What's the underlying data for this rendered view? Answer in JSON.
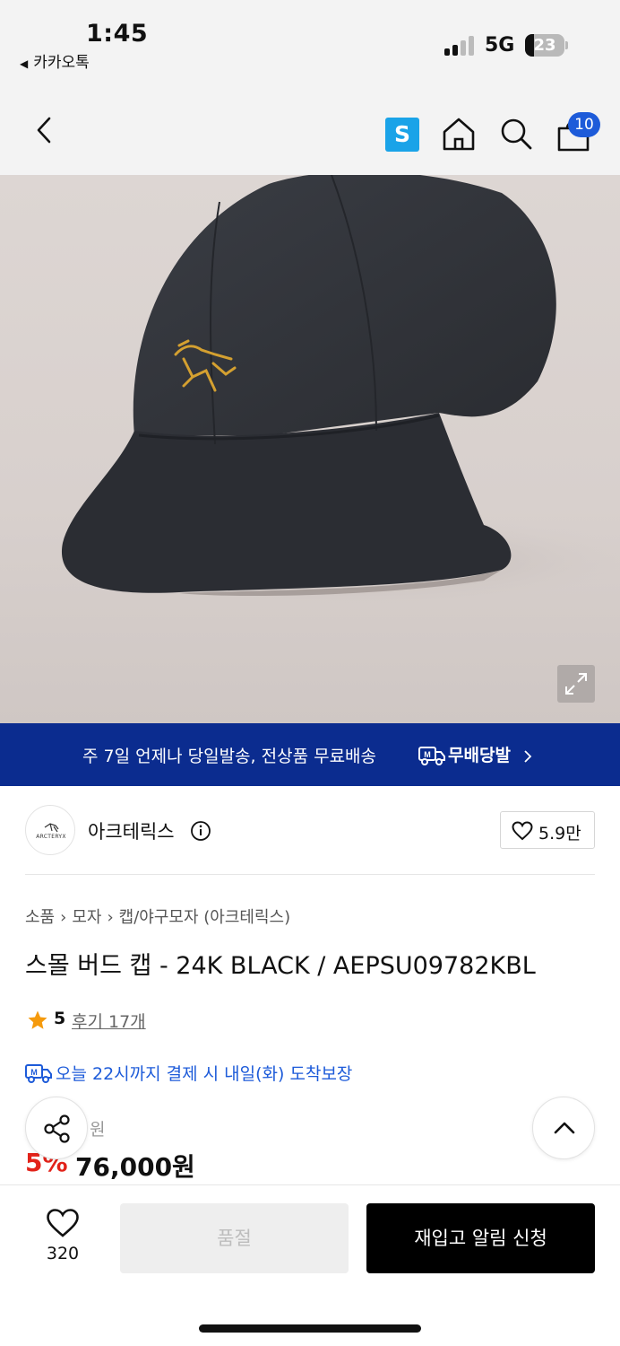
{
  "status_bar": {
    "time": "1:45",
    "back_app": "카카오톡",
    "network": "5G",
    "battery_level": 23,
    "battery_text": "23"
  },
  "nav": {
    "s_badge": "S",
    "cart_count": "10",
    "icons": [
      "back-chevron-icon",
      "s-app-icon",
      "home-icon",
      "search-icon",
      "cart-icon"
    ]
  },
  "banner": {
    "text": "주 7일 언제나 당일발송, 전상품 무료배송",
    "badge": "무배당발"
  },
  "brand": {
    "logo_text": "ARCTERYX",
    "name": "아크테릭스",
    "likes": "5.9만"
  },
  "breadcrumb": [
    "소품",
    "모자",
    "캡/야구모자 (아크테릭스)"
  ],
  "product": {
    "title": "스몰 버드 캡 - 24K BLACK / AEPSU09782KBL",
    "rating": "5",
    "reviews": "후기 17개",
    "delivery": "오늘 22시까지 결제 시 내일(화) 도착보장",
    "original_price": "원",
    "discount": "5%",
    "price": "76,000원"
  },
  "bottom_bar": {
    "wish_count": "320",
    "soldout_label": "품절",
    "restock_label": "재입고 알림 신청"
  },
  "colors": {
    "accent_blue": "#1d5bd9",
    "banner_navy": "#0b2c8f",
    "discount_red": "#e2231a",
    "logo_gold": "#d4a030"
  }
}
